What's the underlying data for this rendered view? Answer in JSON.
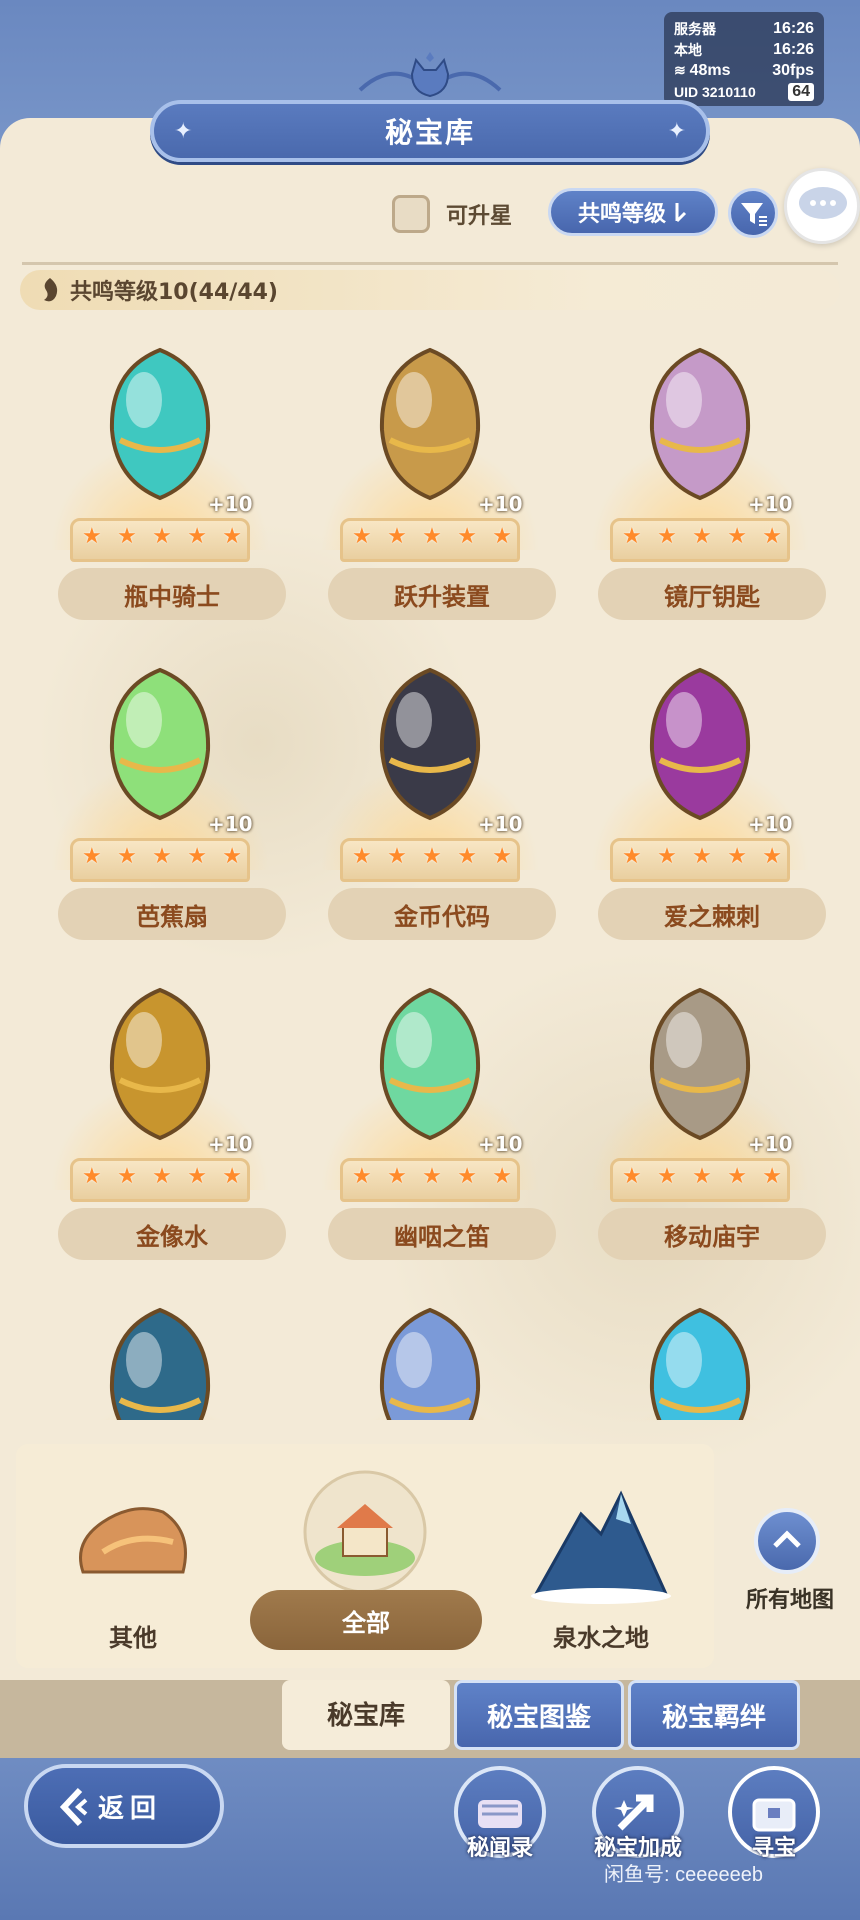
{
  "status": {
    "server_label": "服务器",
    "server_time": "16:26",
    "local_label": "本地",
    "local_time": "16:26",
    "ping": "48ms",
    "fps": "30fps",
    "uid": "UID 3210110",
    "battery": "64"
  },
  "header": {
    "title": "秘宝库"
  },
  "filters": {
    "upgradable_label": "可升星",
    "sort_label": "共鸣等级"
  },
  "group": {
    "label": "共鸣等级10(44/44)"
  },
  "treasures": [
    {
      "name": "瓶中骑士",
      "level": "+10",
      "stars": 5,
      "color": "#3fc8c0"
    },
    {
      "name": "跃升装置",
      "level": "+10",
      "stars": 5,
      "color": "#c89a4a"
    },
    {
      "name": "镜厅钥匙",
      "level": "+10",
      "stars": 5,
      "color": "#c59ac8"
    },
    {
      "name": "芭蕉扇",
      "level": "+10",
      "stars": 5,
      "color": "#8ee07a"
    },
    {
      "name": "金币代码",
      "level": "+10",
      "stars": 5,
      "color": "#3a3a48"
    },
    {
      "name": "爱之棘刺",
      "level": "+10",
      "stars": 5,
      "color": "#9a3a9e"
    },
    {
      "name": "金像水",
      "level": "+10",
      "stars": 5,
      "color": "#c8952e"
    },
    {
      "name": "幽咽之笛",
      "level": "+10",
      "stars": 5,
      "color": "#6fd8a0"
    },
    {
      "name": "移动庙宇",
      "level": "+10",
      "stars": 5,
      "color": "#a89a86"
    },
    {
      "name": "",
      "level": "",
      "stars": 0,
      "color": "#2e6a8a"
    },
    {
      "name": "",
      "level": "",
      "stars": 0,
      "color": "#7b9ad8"
    },
    {
      "name": "",
      "level": "",
      "stars": 0,
      "color": "#3fc0e0"
    }
  ],
  "regions": {
    "other": "其他",
    "all": "全部",
    "spring": "泉水之地",
    "all_maps": "所有地图"
  },
  "tabs": {
    "vault": "秘宝库",
    "atlas": "秘宝图鉴",
    "bonds": "秘宝羁绊"
  },
  "bottom": {
    "back": "返回",
    "stories": "秘闻录",
    "bonus": "秘宝加成",
    "seek": "寻宝"
  },
  "watermark": "闲鱼号: ceeeeeeb"
}
